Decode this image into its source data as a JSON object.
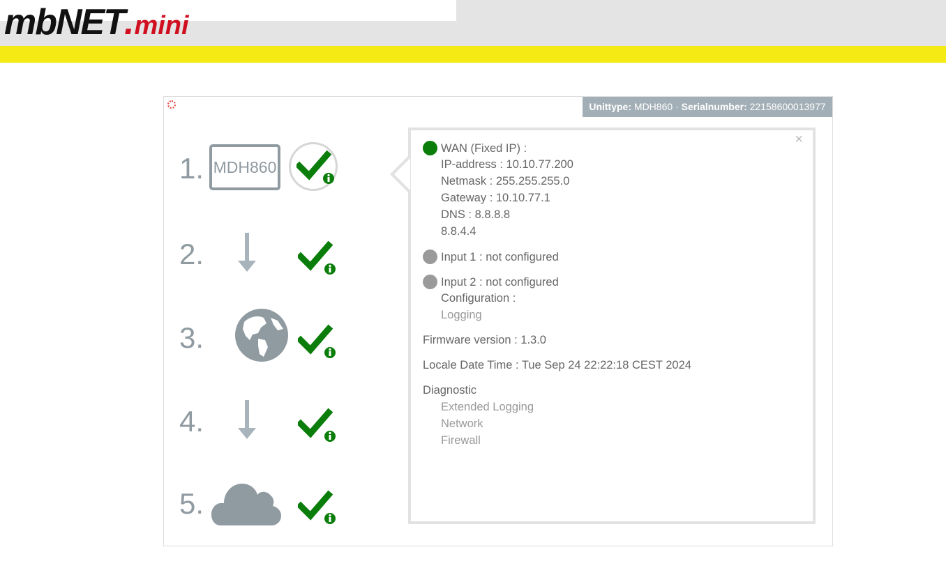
{
  "logo": {
    "main": "mbNET",
    "dot": ".",
    "suffix": "mini"
  },
  "unit": {
    "type_label": "Unittype:",
    "type_value": "MDH860",
    "sep": "·",
    "serial_label": "Serialnumber:",
    "serial_value": "22158600013977"
  },
  "steps": [
    {
      "number": "1.",
      "device_label": "MDH860"
    },
    {
      "number": "2."
    },
    {
      "number": "3."
    },
    {
      "number": "4."
    },
    {
      "number": "5."
    }
  ],
  "details": {
    "close": "×",
    "wan": {
      "title": "WAN (Fixed IP) :",
      "ip": "IP-address : 10.10.77.200",
      "netmask": "Netmask : 255.255.255.0",
      "gateway": "Gateway : 10.10.77.1",
      "dns1": "DNS : 8.8.8.8",
      "dns2": "8.8.4.4"
    },
    "input1": "Input 1 : not configured",
    "input2": "Input 2 : not configured",
    "configuration": "Configuration :",
    "logging": "Logging",
    "firmware": "Firmware version : 1.3.0",
    "locale_time": "Locale Date Time : Tue Sep 24 22:22:18 CEST 2024",
    "diagnostic": "Diagnostic",
    "diag_links": [
      "Extended Logging",
      "Network",
      "Firewall"
    ]
  },
  "colors": {
    "accent_yellow": "#f5ea14",
    "logo_red": "#d01020",
    "ok_green": "#0a7d0a",
    "icon_gray": "#8f9aa1",
    "unitbar_bg": "#a3afb6"
  }
}
